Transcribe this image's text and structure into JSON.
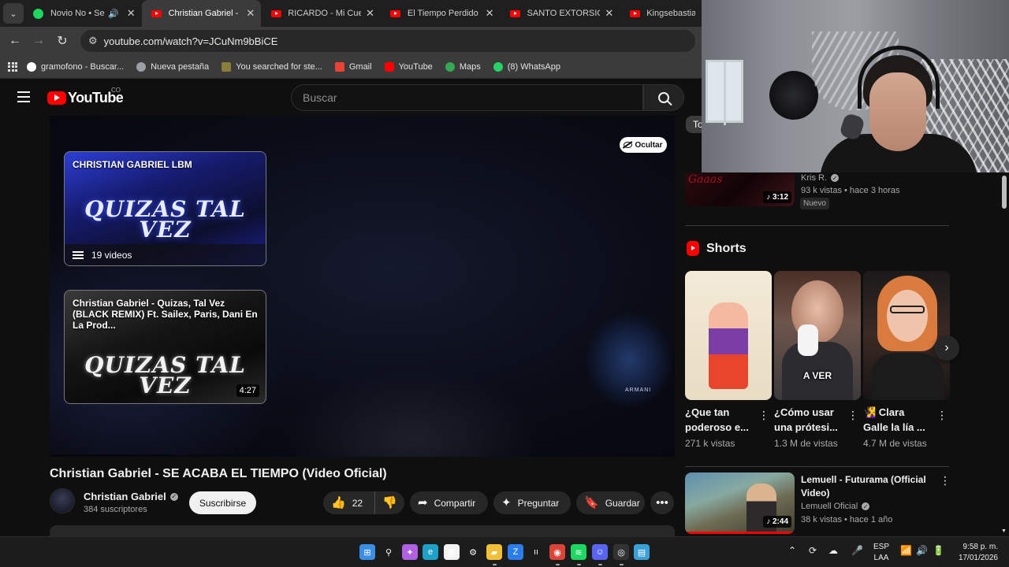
{
  "browser": {
    "tabs": [
      {
        "label": "Novio No • Sech",
        "icon": "spotify-icon",
        "audio": true,
        "active": false
      },
      {
        "label": "Christian Gabriel - SE",
        "icon": "youtube-icon",
        "audio": false,
        "active": true
      },
      {
        "label": "RICARDO - Mi Cuero",
        "icon": "youtube-icon",
        "audio": false,
        "active": false
      },
      {
        "label": "El Tiempo Perdido (E",
        "icon": "youtube-icon",
        "audio": false,
        "active": false
      },
      {
        "label": "SANTO EXTORSIONA",
        "icon": "youtube-icon",
        "audio": false,
        "active": false
      },
      {
        "label": "KingsebastianO",
        "icon": "youtube-icon",
        "audio": false,
        "active": false
      }
    ],
    "url": "youtube.com/watch?v=JCuNm9bBiCE",
    "bookmarks": [
      {
        "label": "gramofono - Buscar...",
        "color": "#ffffff"
      },
      {
        "label": "Nueva pestaña",
        "color": "#9aa0a6"
      },
      {
        "label": "You searched for ste...",
        "color": "#8b7d3a"
      },
      {
        "label": "Gmail",
        "color": "#ea4335"
      },
      {
        "label": "YouTube",
        "color": "#ff0000"
      },
      {
        "label": "Maps",
        "color": "#34a853"
      },
      {
        "label": "(8) WhatsApp",
        "color": "#25d366"
      }
    ]
  },
  "youtube": {
    "logo_text": "YouTube",
    "country_code": "CO",
    "search_placeholder": "Buscar",
    "player": {
      "hide_label": "Ocultar",
      "end_cards": [
        {
          "title": "CHRISTIAN GABRIEL LBM",
          "art": "QUIZAS TAL VEZ",
          "playlist_label": "19 videos"
        },
        {
          "title": "Christian Gabriel - Quizas, Tal Vez (BLACK REMIX) Ft. Sailex, Paris, Dani En La Prod...",
          "art": "QUIZAS TAL VEZ",
          "duration": "4:27"
        }
      ],
      "figure_label": "ARMANI"
    },
    "video": {
      "title": "Christian Gabriel - SE ACABA EL TIEMPO (Video Oficial)",
      "channel": "Christian Gabriel",
      "subscribers": "384 suscriptores",
      "subscribe_label": "Suscribirse",
      "likes": "22",
      "share_label": "Compartir",
      "ask_label": "Preguntar",
      "save_label": "Guardar"
    },
    "sidebar": {
      "top_peek_label": "To",
      "kris": {
        "thumb_text": "Gaaas",
        "channel": "Kris R.",
        "views": "93 k vistas • hace 3 horas",
        "badge": "Nuevo",
        "duration": "3:12"
      },
      "shorts_title": "Shorts",
      "shorts": [
        {
          "title": "¿Que tan poderoso e...",
          "views": "271 k vistas"
        },
        {
          "title": "¿Cómo usar una prótesi...",
          "views": "1.3 M de vistas",
          "caption": "A VER"
        },
        {
          "title": "🧏‍♀️ Clara Galle la lía ...",
          "views": "4.7 M de vistas"
        }
      ],
      "lemuell": {
        "title": "Lemuell - Futurama (Official Video)",
        "channel": "Lemuell Oficial",
        "views": "38 k vistas • hace 1 año",
        "duration": "2:44"
      }
    }
  },
  "taskbar": {
    "apps": [
      {
        "icon": "windows-start-icon",
        "color": "#3a8ee6",
        "glyph": "⊞"
      },
      {
        "icon": "search-icon",
        "color": "transparent",
        "glyph": "⚲"
      },
      {
        "icon": "copilot-icon",
        "color": "#b060e0",
        "glyph": "✦"
      },
      {
        "icon": "edge-icon",
        "color": "#1fa0c8",
        "glyph": "e"
      },
      {
        "icon": "store-icon",
        "color": "#f2f2f2",
        "glyph": "▦"
      },
      {
        "icon": "settings-icon",
        "color": "transparent",
        "glyph": "⚙"
      },
      {
        "icon": "file-explorer-icon",
        "color": "#f2c037",
        "glyph": "▰"
      },
      {
        "icon": "vpn-icon",
        "color": "#2b7de9",
        "glyph": "Z"
      },
      {
        "icon": "bridge-icon",
        "color": "transparent",
        "glyph": "ıı"
      },
      {
        "icon": "chrome-icon",
        "color": "#db4437",
        "glyph": "◉"
      },
      {
        "icon": "spotify-icon",
        "color": "#1ed760",
        "glyph": "≋"
      },
      {
        "icon": "discord-icon",
        "color": "#5865f2",
        "glyph": "☺"
      },
      {
        "icon": "obs-icon",
        "color": "#333333",
        "glyph": "◎"
      },
      {
        "icon": "notepad-icon",
        "color": "#3aa0d8",
        "glyph": "▤"
      }
    ],
    "language_top": "ESP",
    "language_bottom": "LAA",
    "time": "9:58 p. m.",
    "date": "17/01/2026"
  }
}
